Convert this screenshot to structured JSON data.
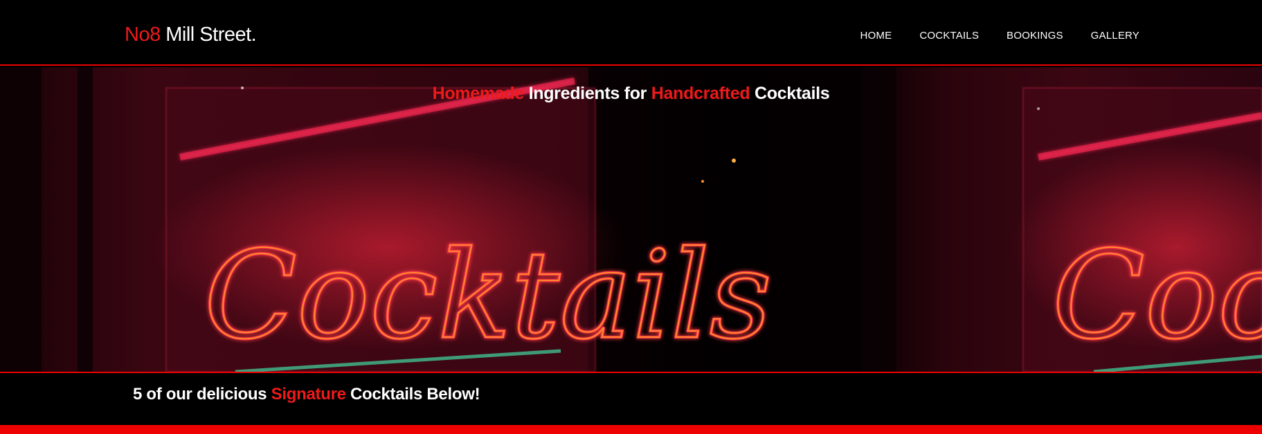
{
  "brand": {
    "accent": "No8",
    "rest": " Mill Street."
  },
  "nav": {
    "items": [
      {
        "label": "HOME"
      },
      {
        "label": "COCKTAILS"
      },
      {
        "label": "BOOKINGS"
      },
      {
        "label": "GALLERY"
      }
    ]
  },
  "hero": {
    "heading": {
      "part1": "Homemade",
      "part2": " Ingredients for ",
      "part3": "Handcrafted",
      "part4": " Cocktails"
    },
    "image_sign_text": "Cocktails"
  },
  "tagline": {
    "part1": "5 of our delicious ",
    "part2": "Signature",
    "part3": " Cocktails Below!"
  },
  "colors": {
    "accent": "#ee1a1a",
    "background": "#000000",
    "border": "#ee0000"
  }
}
